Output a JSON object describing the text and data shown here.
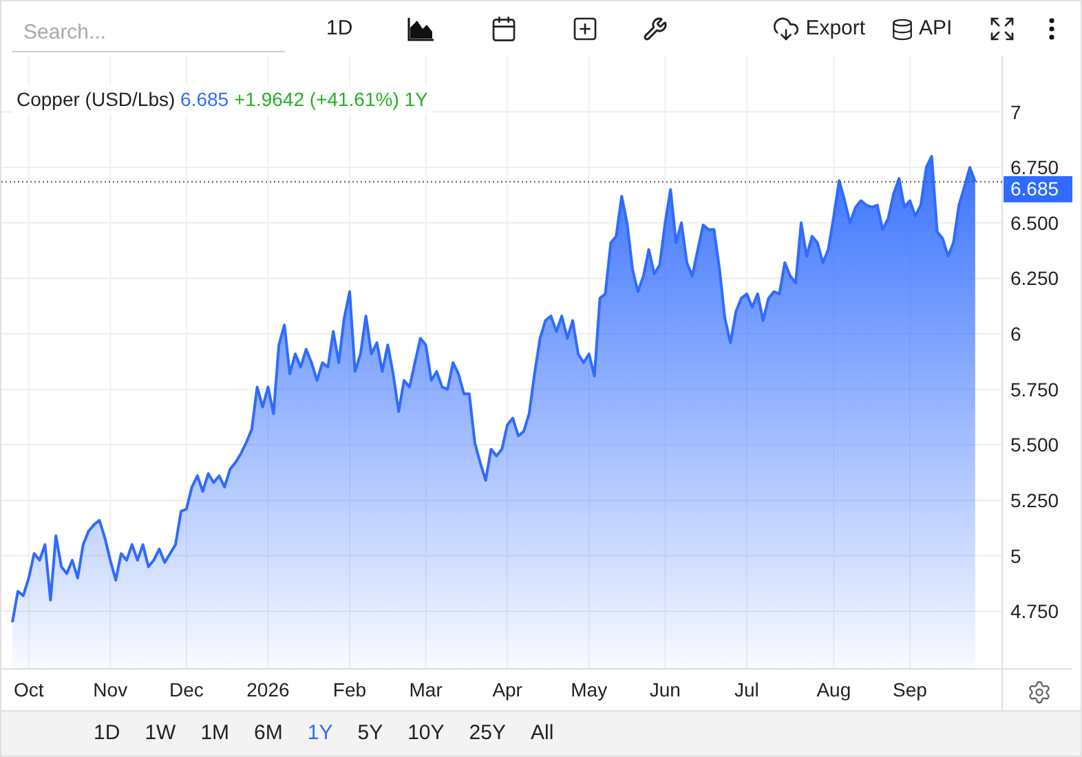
{
  "toolbar": {
    "search": {
      "placeholder": "Search..."
    },
    "interval": "1D",
    "export": "Export",
    "api": "API"
  },
  "chart": {
    "legend": {
      "price": "6.685",
      "change": "+1.9642 (+41.61%) 1Y"
    },
    "price_tag": "6.685",
    "chart_data": {
      "type": "area",
      "grid": true,
      "ref_lines": [
        {
          "axis": "y",
          "value": 6.685
        }
      ],
      "ylim": [
        4.49,
        7.25
      ],
      "categories": [
        null,
        null,
        null,
        "Oct",
        null,
        null,
        null,
        null,
        null,
        null,
        null,
        null,
        null,
        null,
        null,
        null,
        null,
        null,
        "Nov",
        null,
        null,
        null,
        null,
        null,
        null,
        null,
        null,
        null,
        null,
        null,
        null,
        null,
        "Dec",
        null,
        null,
        null,
        null,
        null,
        null,
        null,
        null,
        null,
        null,
        null,
        null,
        null,
        null,
        "2026",
        null,
        null,
        null,
        null,
        null,
        null,
        null,
        null,
        null,
        null,
        null,
        null,
        null,
        null,
        "Feb",
        null,
        null,
        null,
        null,
        null,
        null,
        null,
        null,
        null,
        null,
        null,
        null,
        null,
        "Mar",
        null,
        null,
        null,
        null,
        null,
        null,
        null,
        null,
        null,
        null,
        null,
        null,
        null,
        null,
        "Apr",
        null,
        null,
        null,
        null,
        null,
        null,
        null,
        null,
        null,
        null,
        null,
        null,
        null,
        null,
        "May",
        null,
        null,
        null,
        null,
        null,
        null,
        null,
        null,
        null,
        null,
        null,
        null,
        null,
        "Jun",
        null,
        null,
        null,
        null,
        null,
        null,
        null,
        null,
        null,
        null,
        null,
        null,
        null,
        null,
        "Jul",
        null,
        null,
        null,
        null,
        null,
        null,
        null,
        null,
        null,
        null,
        null,
        null,
        null,
        null,
        null,
        "Aug",
        null,
        null,
        null,
        null,
        null,
        null,
        null,
        null,
        null,
        null,
        null,
        null,
        null,
        "Sep",
        null,
        null,
        null,
        null,
        null,
        null,
        null,
        null,
        null,
        null,
        null,
        null
      ],
      "yticks": [
        {
          "value": 4.75,
          "label": "4.750"
        },
        {
          "value": 5,
          "label": "5"
        },
        {
          "value": 5.25,
          "label": "5.250"
        },
        {
          "value": 5.5,
          "label": "5.500"
        },
        {
          "value": 5.75,
          "label": "5.750"
        },
        {
          "value": 6,
          "label": "6"
        },
        {
          "value": 6.25,
          "label": "6.250"
        },
        {
          "value": 6.5,
          "label": "6.500"
        },
        {
          "value": 6.75,
          "label": "6.750"
        },
        {
          "value": 7,
          "label": "7"
        }
      ],
      "series": [
        {
          "name": "Copper (USD/Lbs)",
          "color": "#2f6bff",
          "values": [
            4.7,
            4.84,
            4.82,
            4.9,
            5.01,
            4.98,
            5.05,
            4.8,
            5.09,
            4.95,
            4.92,
            4.98,
            4.9,
            5.05,
            5.11,
            5.14,
            5.16,
            5.08,
            4.98,
            4.89,
            5.01,
            4.98,
            5.05,
            4.98,
            5.05,
            4.95,
            4.98,
            5.03,
            4.97,
            5.01,
            5.05,
            5.2,
            5.21,
            5.31,
            5.36,
            5.29,
            5.37,
            5.33,
            5.36,
            5.31,
            5.39,
            5.42,
            5.46,
            5.51,
            5.57,
            5.76,
            5.67,
            5.76,
            5.64,
            5.95,
            6.04,
            5.82,
            5.91,
            5.85,
            5.93,
            5.87,
            5.79,
            5.87,
            5.85,
            6.01,
            5.87,
            6.07,
            6.19,
            5.83,
            5.91,
            6.08,
            5.91,
            5.96,
            5.83,
            5.95,
            5.82,
            5.65,
            5.79,
            5.76,
            5.87,
            5.98,
            5.95,
            5.79,
            5.83,
            5.76,
            5.75,
            5.87,
            5.82,
            5.73,
            5.73,
            5.51,
            5.42,
            5.34,
            5.48,
            5.45,
            5.48,
            5.59,
            5.62,
            5.54,
            5.56,
            5.64,
            5.82,
            5.98,
            6.06,
            6.08,
            6.01,
            6.08,
            5.98,
            6.06,
            5.91,
            5.87,
            5.91,
            5.81,
            6.16,
            6.18,
            6.41,
            6.44,
            6.62,
            6.5,
            6.29,
            6.19,
            6.26,
            6.38,
            6.27,
            6.31,
            6.5,
            6.65,
            6.41,
            6.5,
            6.32,
            6.26,
            6.38,
            6.49,
            6.47,
            6.47,
            6.29,
            6.07,
            5.96,
            6.1,
            6.16,
            6.18,
            6.12,
            6.18,
            6.06,
            6.16,
            6.19,
            6.18,
            6.32,
            6.26,
            6.23,
            6.5,
            6.35,
            6.44,
            6.41,
            6.32,
            6.38,
            6.53,
            6.69,
            6.6,
            6.5,
            6.57,
            6.6,
            6.58,
            6.57,
            6.58,
            6.47,
            6.52,
            6.63,
            6.7,
            6.57,
            6.6,
            6.53,
            6.58,
            6.75,
            6.8,
            6.46,
            6.43,
            6.35,
            6.41,
            6.58,
            6.66,
            6.75,
            6.685
          ]
        }
      ]
    }
  },
  "ranges": [
    {
      "label": "1D",
      "selected": false
    },
    {
      "label": "1W",
      "selected": false
    },
    {
      "label": "1M",
      "selected": false
    },
    {
      "label": "6M",
      "selected": false
    },
    {
      "label": "1Y",
      "selected": true
    },
    {
      "label": "5Y",
      "selected": false
    },
    {
      "label": "10Y",
      "selected": false
    },
    {
      "label": "25Y",
      "selected": false
    },
    {
      "label": "All",
      "selected": false
    }
  ]
}
